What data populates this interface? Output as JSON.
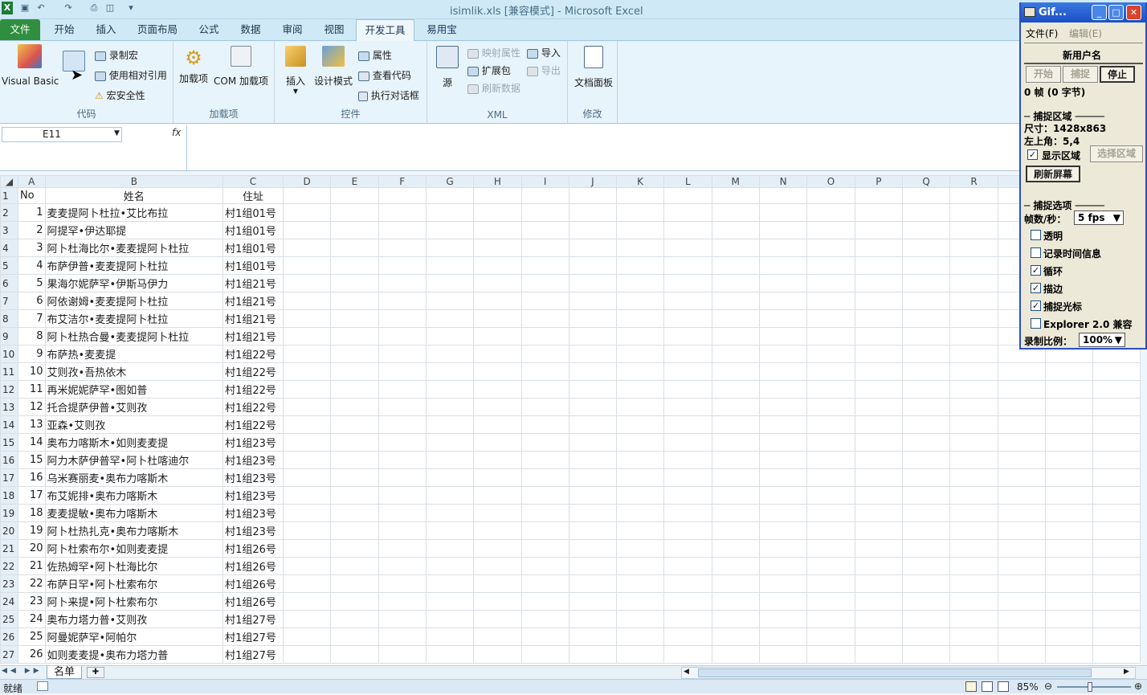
{
  "window": {
    "title": "isimlik.xls  [兼容模式]  -  Microsoft Excel"
  },
  "ribbon_tabs": [
    "文件",
    "开始",
    "插入",
    "页面布局",
    "公式",
    "数据",
    "审阅",
    "视图",
    "开发工具",
    "易用宝"
  ],
  "active_tab": "开发工具",
  "ribbon": {
    "code": {
      "label": "代码",
      "vb": "Visual Basic",
      "macro": "宏",
      "record": "录制宏",
      "relative": "使用相对引用",
      "security": "宏安全性"
    },
    "addins": {
      "label": "加载项",
      "addins": "加载项",
      "com": "COM 加载项"
    },
    "controls": {
      "label": "控件",
      "insert": "插入",
      "design": "设计模式",
      "props": "属性",
      "viewcode": "查看代码",
      "dialog": "执行对话框"
    },
    "xml": {
      "label": "XML",
      "source": "源",
      "map": "映射属性",
      "expand": "扩展包",
      "refresh": "刷新数据",
      "import": "导入",
      "export": "导出"
    },
    "modify": {
      "label": "修改",
      "docpanel": "文档面板"
    }
  },
  "formula_bar": {
    "name_box": "E11",
    "fx": "fx",
    "value": ""
  },
  "columns": [
    "A",
    "B",
    "C",
    "D",
    "E",
    "F",
    "G",
    "H",
    "I",
    "J",
    "K",
    "L",
    "M",
    "N",
    "O",
    "P",
    "Q",
    "R"
  ],
  "header_row": {
    "a": "No",
    "b": "姓名",
    "c": "住址"
  },
  "rows": [
    [
      "1",
      "麦麦提阿卜杜拉•艾比布拉",
      "村1组01号"
    ],
    [
      "2",
      "阿提罕•伊达耶提",
      "村1组01号"
    ],
    [
      "3",
      "阿卜杜海比尔•麦麦提阿卜杜拉",
      "村1组01号"
    ],
    [
      "4",
      "布萨伊普•麦麦提阿卜杜拉",
      "村1组01号"
    ],
    [
      "5",
      "果海尔妮萨罕•伊斯马伊力",
      "村1组21号"
    ],
    [
      "6",
      "阿依谢姆•麦麦提阿卜杜拉",
      "村1组21号"
    ],
    [
      "7",
      "布艾洁尔•麦麦提阿卜杜拉",
      "村1组21号"
    ],
    [
      "8",
      "阿卜杜热合曼•麦麦提阿卜杜拉",
      "村1组21号"
    ],
    [
      "9",
      "布萨热•麦麦提",
      "村1组22号"
    ],
    [
      "10",
      "艾则孜•吾热依木",
      "村1组22号"
    ],
    [
      "11",
      "再米妮妮萨罕•图如普",
      "村1组22号"
    ],
    [
      "12",
      "托合提萨伊普•艾则孜",
      "村1组22号"
    ],
    [
      "13",
      "亚森•艾则孜",
      "村1组22号"
    ],
    [
      "14",
      "奥布力喀斯木•如则麦麦提",
      "村1组23号"
    ],
    [
      "15",
      "阿力木萨伊普罕•阿卜杜喀迪尔",
      "村1组23号"
    ],
    [
      "16",
      "乌米赛丽麦•奥布力喀斯木",
      "村1组23号"
    ],
    [
      "17",
      "布艾妮排•奥布力喀斯木",
      "村1组23号"
    ],
    [
      "18",
      "麦麦提敏•奥布力喀斯木",
      "村1组23号"
    ],
    [
      "19",
      "阿卜杜热扎克•奥布力喀斯木",
      "村1组23号"
    ],
    [
      "20",
      "阿卜杜索布尔•如则麦麦提",
      "村1组26号"
    ],
    [
      "21",
      "佐热姆罕•阿卜杜海比尔",
      "村1组26号"
    ],
    [
      "22",
      "布萨日罕•阿卜杜索布尔",
      "村1组26号"
    ],
    [
      "23",
      "阿卜来提•阿卜杜索布尔",
      "村1组26号"
    ],
    [
      "24",
      "奥布力塔力普•艾则孜",
      "村1组27号"
    ],
    [
      "25",
      "阿曼妮萨罕•阿帕尔",
      "村1组27号"
    ],
    [
      "26",
      "如则麦麦提•奥布力塔力普",
      "村1组27号"
    ]
  ],
  "sheet_tab": "名单",
  "status": {
    "ready": "就绪",
    "zoom": "85%"
  },
  "gif": {
    "title": "Gif...",
    "menu_file": "文件(F)",
    "menu_edit": "编辑(E)",
    "user": "新用户名",
    "btn_start": "开始",
    "btn_capture": "捕捉",
    "btn_stop": "停止",
    "frames": "0 帧 (0 字节)",
    "area_label": "捕捉区域",
    "size": "尺寸：1428x863",
    "topleft": "左上角：5,4",
    "show_area": "显示区域",
    "select_area": "选择区域",
    "refresh": "刷新屏幕",
    "options_label": "捕捉选项",
    "fps_label": "帧数/秒：",
    "fps_value": "5 fps",
    "opt_transparent": "透明",
    "opt_timeinfo": "记录时间信息",
    "opt_loop": "循环",
    "opt_border": "描边",
    "opt_cursor": "捕捉光标",
    "opt_explorer": "Explorer 2.0 兼容",
    "ratio_label": "录制比例：",
    "ratio_value": "100%"
  }
}
